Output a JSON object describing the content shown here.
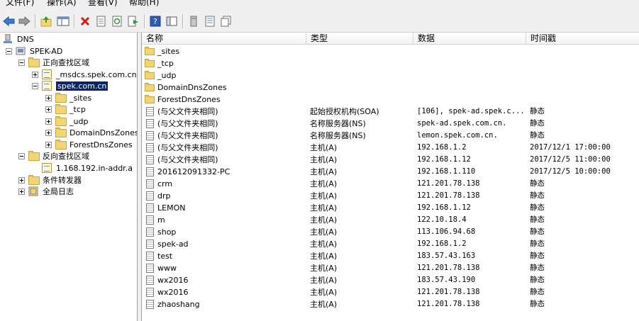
{
  "menu": [
    "文件(F)",
    "操作(A)",
    "查看(V)",
    "帮助(H)"
  ],
  "toolbar_icons": [
    "back-arrow-icon",
    "forward-arrow-icon",
    "up-folder-icon",
    "show-hide-tree-icon",
    "delete-icon",
    "properties-icon",
    "refresh-icon",
    "export-list-icon",
    "help-icon",
    "show-console-icon",
    "server-icon",
    "zone-icon",
    "record-icon"
  ],
  "tree": {
    "root": "DNS",
    "server": "SPEK-AD",
    "forward": "正向查找区域",
    "msdcs": "_msdcs.spek.com.cn",
    "zone": "spek.com.cn",
    "sites": "_sites",
    "tcp": "_tcp",
    "udp": "_udp",
    "domaindns": "DomainDnsZones",
    "forestdns": "ForestDnsZones",
    "reverse": "反向查找区域",
    "revzone": "1.168.192.in-addr.a",
    "conditional": "条件转发器",
    "logs": "全局日志"
  },
  "list": {
    "headers": [
      "名称",
      "类型",
      "数据",
      "时间戳"
    ],
    "rows": [
      {
        "icon": "folder",
        "name": "_sites",
        "type": "",
        "data": "",
        "ts": ""
      },
      {
        "icon": "folder",
        "name": "_tcp",
        "type": "",
        "data": "",
        "ts": ""
      },
      {
        "icon": "folder",
        "name": "_udp",
        "type": "",
        "data": "",
        "ts": ""
      },
      {
        "icon": "folder",
        "name": "DomainDnsZones",
        "type": "",
        "data": "",
        "ts": ""
      },
      {
        "icon": "folder",
        "name": "ForestDnsZones",
        "type": "",
        "data": "",
        "ts": ""
      },
      {
        "icon": "record",
        "name": "(与父文件夹相同)",
        "type": "起始授权机构(SOA)",
        "data": "[106], spek-ad.spek.c...",
        "ts": "静态"
      },
      {
        "icon": "record",
        "name": "(与父文件夹相同)",
        "type": "名称服务器(NS)",
        "data": "spek-ad.spek.com.cn.",
        "ts": "静态"
      },
      {
        "icon": "record",
        "name": "(与父文件夹相同)",
        "type": "名称服务器(NS)",
        "data": "lemon.spek.com.cn.",
        "ts": "静态"
      },
      {
        "icon": "record",
        "name": "(与父文件夹相同)",
        "type": "主机(A)",
        "data": "192.168.1.2",
        "ts": "2017/12/1 17:00:00"
      },
      {
        "icon": "record",
        "name": "(与父文件夹相同)",
        "type": "主机(A)",
        "data": "192.168.1.12",
        "ts": "2017/12/5 11:00:00"
      },
      {
        "icon": "record",
        "name": "201612091332-PC",
        "type": "主机(A)",
        "data": "192.168.1.110",
        "ts": "2017/12/5 10:00:00"
      },
      {
        "icon": "record",
        "name": "crm",
        "type": "主机(A)",
        "data": "121.201.78.138",
        "ts": "静态"
      },
      {
        "icon": "record",
        "name": "drp",
        "type": "主机(A)",
        "data": "121.201.78.138",
        "ts": "静态"
      },
      {
        "icon": "record",
        "name": "LEMON",
        "type": "主机(A)",
        "data": "192.168.1.12",
        "ts": "静态"
      },
      {
        "icon": "record",
        "name": "m",
        "type": "主机(A)",
        "data": "122.10.18.4",
        "ts": "静态"
      },
      {
        "icon": "record",
        "name": "shop",
        "type": "主机(A)",
        "data": "113.106.94.68",
        "ts": "静态"
      },
      {
        "icon": "record",
        "name": "spek-ad",
        "type": "主机(A)",
        "data": "192.168.1.2",
        "ts": "静态"
      },
      {
        "icon": "record",
        "name": "test",
        "type": "主机(A)",
        "data": "183.57.43.163",
        "ts": "静态"
      },
      {
        "icon": "record",
        "name": "www",
        "type": "主机(A)",
        "data": "121.201.78.138",
        "ts": "静态"
      },
      {
        "icon": "record",
        "name": "wx2016",
        "type": "主机(A)",
        "data": "183.57.43.190",
        "ts": "静态"
      },
      {
        "icon": "record",
        "name": "wx2016",
        "type": "主机(A)",
        "data": "121.201.78.138",
        "ts": "静态"
      },
      {
        "icon": "record",
        "name": "zhaoshang",
        "type": "主机(A)",
        "data": "121.201.78.138",
        "ts": "静态"
      }
    ]
  },
  "colors": {
    "selection": "#0a246a",
    "folder": "#f2d576",
    "toolbar": "#f0f0f0"
  }
}
